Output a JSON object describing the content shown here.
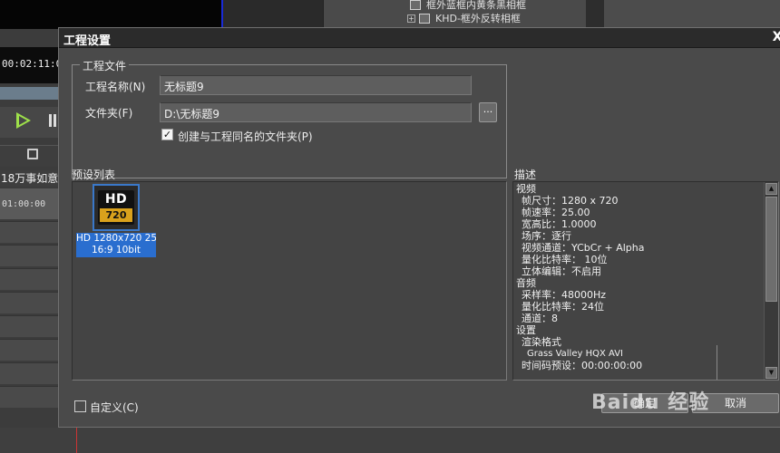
{
  "background": {
    "tree_items": [
      {
        "label": "框外蓝框内黄条黑相框"
      },
      {
        "label": "KHD-框外反转相框",
        "expander": "+"
      }
    ],
    "timecode": "00:02:11:0",
    "track_label": "18万事如意",
    "ruler_timecode": "01:00:00"
  },
  "dialog": {
    "title": "工程设置",
    "close_label": "X",
    "project_group": {
      "title": "工程文件",
      "name_label": "工程名称(N)",
      "name_value": "无标题9",
      "folder_label": "文件夹(F)",
      "folder_value": "D:\\无标题9",
      "browse_label": "...",
      "create_folder_label": "创建与工程同名的文件夹(P)",
      "create_folder_checked": true
    },
    "preset_list": {
      "label": "预设列表",
      "items": [
        {
          "logo_top": "HD",
          "logo_bottom": "720",
          "caption_line1": "HD 1280x720 25p",
          "caption_line2": "16:9 10bit",
          "selected": true
        }
      ]
    },
    "description": {
      "label": "描述",
      "lines": [
        {
          "text": "视频",
          "level": 0
        },
        {
          "text": "帧尺寸：1280 x 720",
          "level": 1
        },
        {
          "text": "帧速率：25.00",
          "level": 1
        },
        {
          "text": "宽高比：1.0000",
          "level": 1
        },
        {
          "text": "场序：逐行",
          "level": 1
        },
        {
          "text": "视频通道：YCbCr + Alpha",
          "level": 1
        },
        {
          "text": "量化比特率： 10位",
          "level": 1
        },
        {
          "text": "立体编辑：不启用",
          "level": 1
        },
        {
          "text": "音频",
          "level": 0
        },
        {
          "text": "采样率：48000Hz",
          "level": 1
        },
        {
          "text": "量化比特率：24位",
          "level": 1
        },
        {
          "text": "通道：8",
          "level": 1
        },
        {
          "text": "设置",
          "level": 0
        },
        {
          "text": "渲染格式",
          "level": 1
        },
        {
          "text": "Grass Valley HQX AVI",
          "level": 2
        },
        {
          "text": "时间码预设：00:00:00:00",
          "level": 1
        }
      ],
      "scroll_up": "▲",
      "scroll_down": "▼"
    },
    "custom_label": "自定义(C)",
    "custom_checked": false,
    "ok_label": "确定",
    "cancel_label": "取消"
  },
  "watermark": "Baidu 经验"
}
